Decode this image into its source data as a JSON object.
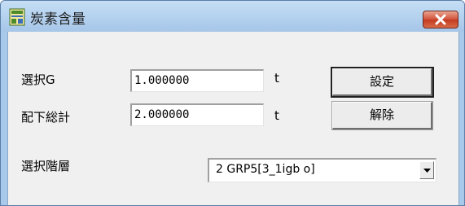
{
  "window": {
    "title": "炭素含量"
  },
  "fields": {
    "selected_g": {
      "label": "選択G",
      "value": "1.000000",
      "unit": "t"
    },
    "subtotal": {
      "label": "配下総計",
      "value": "2.000000",
      "unit": "t"
    }
  },
  "buttons": {
    "set_label": "設定",
    "release_label": "解除"
  },
  "layer": {
    "label": "選択階層",
    "selected": "2 GRP5[3_1igb o]"
  },
  "icons": {
    "app": "app-icon",
    "close": "close-icon",
    "dropdown": "chevron-down-icon"
  },
  "colors": {
    "titlebar": "#b5d2ef",
    "close_button": "#c9452c",
    "client": "#f0f0f0"
  }
}
